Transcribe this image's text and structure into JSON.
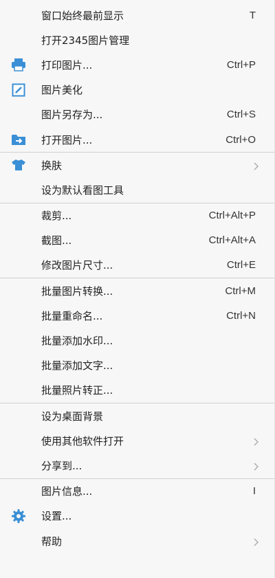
{
  "menu": {
    "items": [
      {
        "label": "窗口始终最前显示",
        "shortcut": "T"
      },
      {
        "label": "打开2345图片管理",
        "shortcut": ""
      },
      {
        "label": "打印图片...",
        "shortcut": "Ctrl+P",
        "icon": "printer-icon"
      },
      {
        "label": "图片美化",
        "shortcut": "",
        "icon": "edit-icon"
      },
      {
        "label": "图片另存为...",
        "shortcut": "Ctrl+S"
      },
      {
        "label": "打开图片...",
        "shortcut": "Ctrl+O",
        "icon": "folder-open-icon"
      },
      {
        "label": "换肤",
        "icon": "tshirt-icon",
        "submenu": true
      },
      {
        "label": "设为默认看图工具"
      },
      {
        "label": "裁剪...",
        "shortcut": "Ctrl+Alt+P"
      },
      {
        "label": "截图...",
        "shortcut": "Ctrl+Alt+A"
      },
      {
        "label": "修改图片尺寸...",
        "shortcut": "Ctrl+E"
      },
      {
        "label": "批量图片转换...",
        "shortcut": "Ctrl+M"
      },
      {
        "label": "批量重命名...",
        "shortcut": "Ctrl+N"
      },
      {
        "label": "批量添加水印..."
      },
      {
        "label": "批量添加文字..."
      },
      {
        "label": "批量照片转正..."
      },
      {
        "label": "设为桌面背景"
      },
      {
        "label": "使用其他软件打开",
        "submenu": true
      },
      {
        "label": "分享到...",
        "submenu": true
      },
      {
        "label": "图片信息...",
        "shortcut": "I"
      },
      {
        "label": "设置...",
        "icon": "gear-icon"
      },
      {
        "label": "帮助",
        "submenu": true
      }
    ]
  },
  "colors": {
    "accent": "#3a8fd6",
    "separator": "#cfcfcf",
    "background": "#f7f7f7"
  }
}
